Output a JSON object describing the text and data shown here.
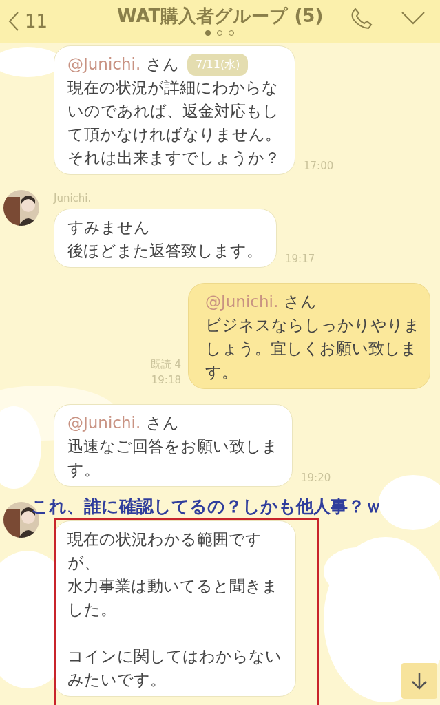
{
  "header": {
    "back_count": "11",
    "title": "WAT購入者グループ (5)",
    "page_dots": [
      {
        "selected": true
      },
      {
        "selected": false
      },
      {
        "selected": false
      }
    ]
  },
  "date_badge": "7/11(水)",
  "messages": [
    {
      "kind": "incoming",
      "avatar": false,
      "mention": "@Junichi.",
      "honorific": "さん",
      "paragraphs": [
        [
          "現在の状況が詳細にわからな",
          "いのであれば、返金対応もし",
          "て頂かなければなりません。",
          "それは出来ますでしょうか？"
        ]
      ],
      "time": "17:00"
    },
    {
      "kind": "incoming",
      "avatar": true,
      "sender": "Junichi.",
      "paragraphs": [
        [
          "すみません",
          "後ほどまた返答致します。"
        ]
      ],
      "time": "19:17"
    },
    {
      "kind": "outgoing",
      "mention": "@Junichi.",
      "honorific": "さん",
      "paragraphs": [
        [
          "ビジネスならしっかりやりま",
          "しょう。宜しくお願い致しま",
          "す。"
        ]
      ],
      "read": "既読 4",
      "time": "19:18"
    },
    {
      "kind": "incoming",
      "avatar": false,
      "mention": "@Junichi.",
      "honorific": "さん",
      "paragraphs": [
        [
          "迅速なご回答をお願い致しま",
          "す。"
        ]
      ],
      "time": "19:20"
    },
    {
      "kind": "incoming",
      "avatar": true,
      "highlighted": true,
      "paragraphs": [
        [
          "現在の状況わかる範囲です",
          "が、",
          "水力事業は動いてると聞きま",
          "した。"
        ],
        [
          "コインに関してはわからない",
          "みたいです。"
        ]
      ]
    }
  ],
  "annotation": "これ、誰に確認してるの？しかも他人事？ｗ"
}
